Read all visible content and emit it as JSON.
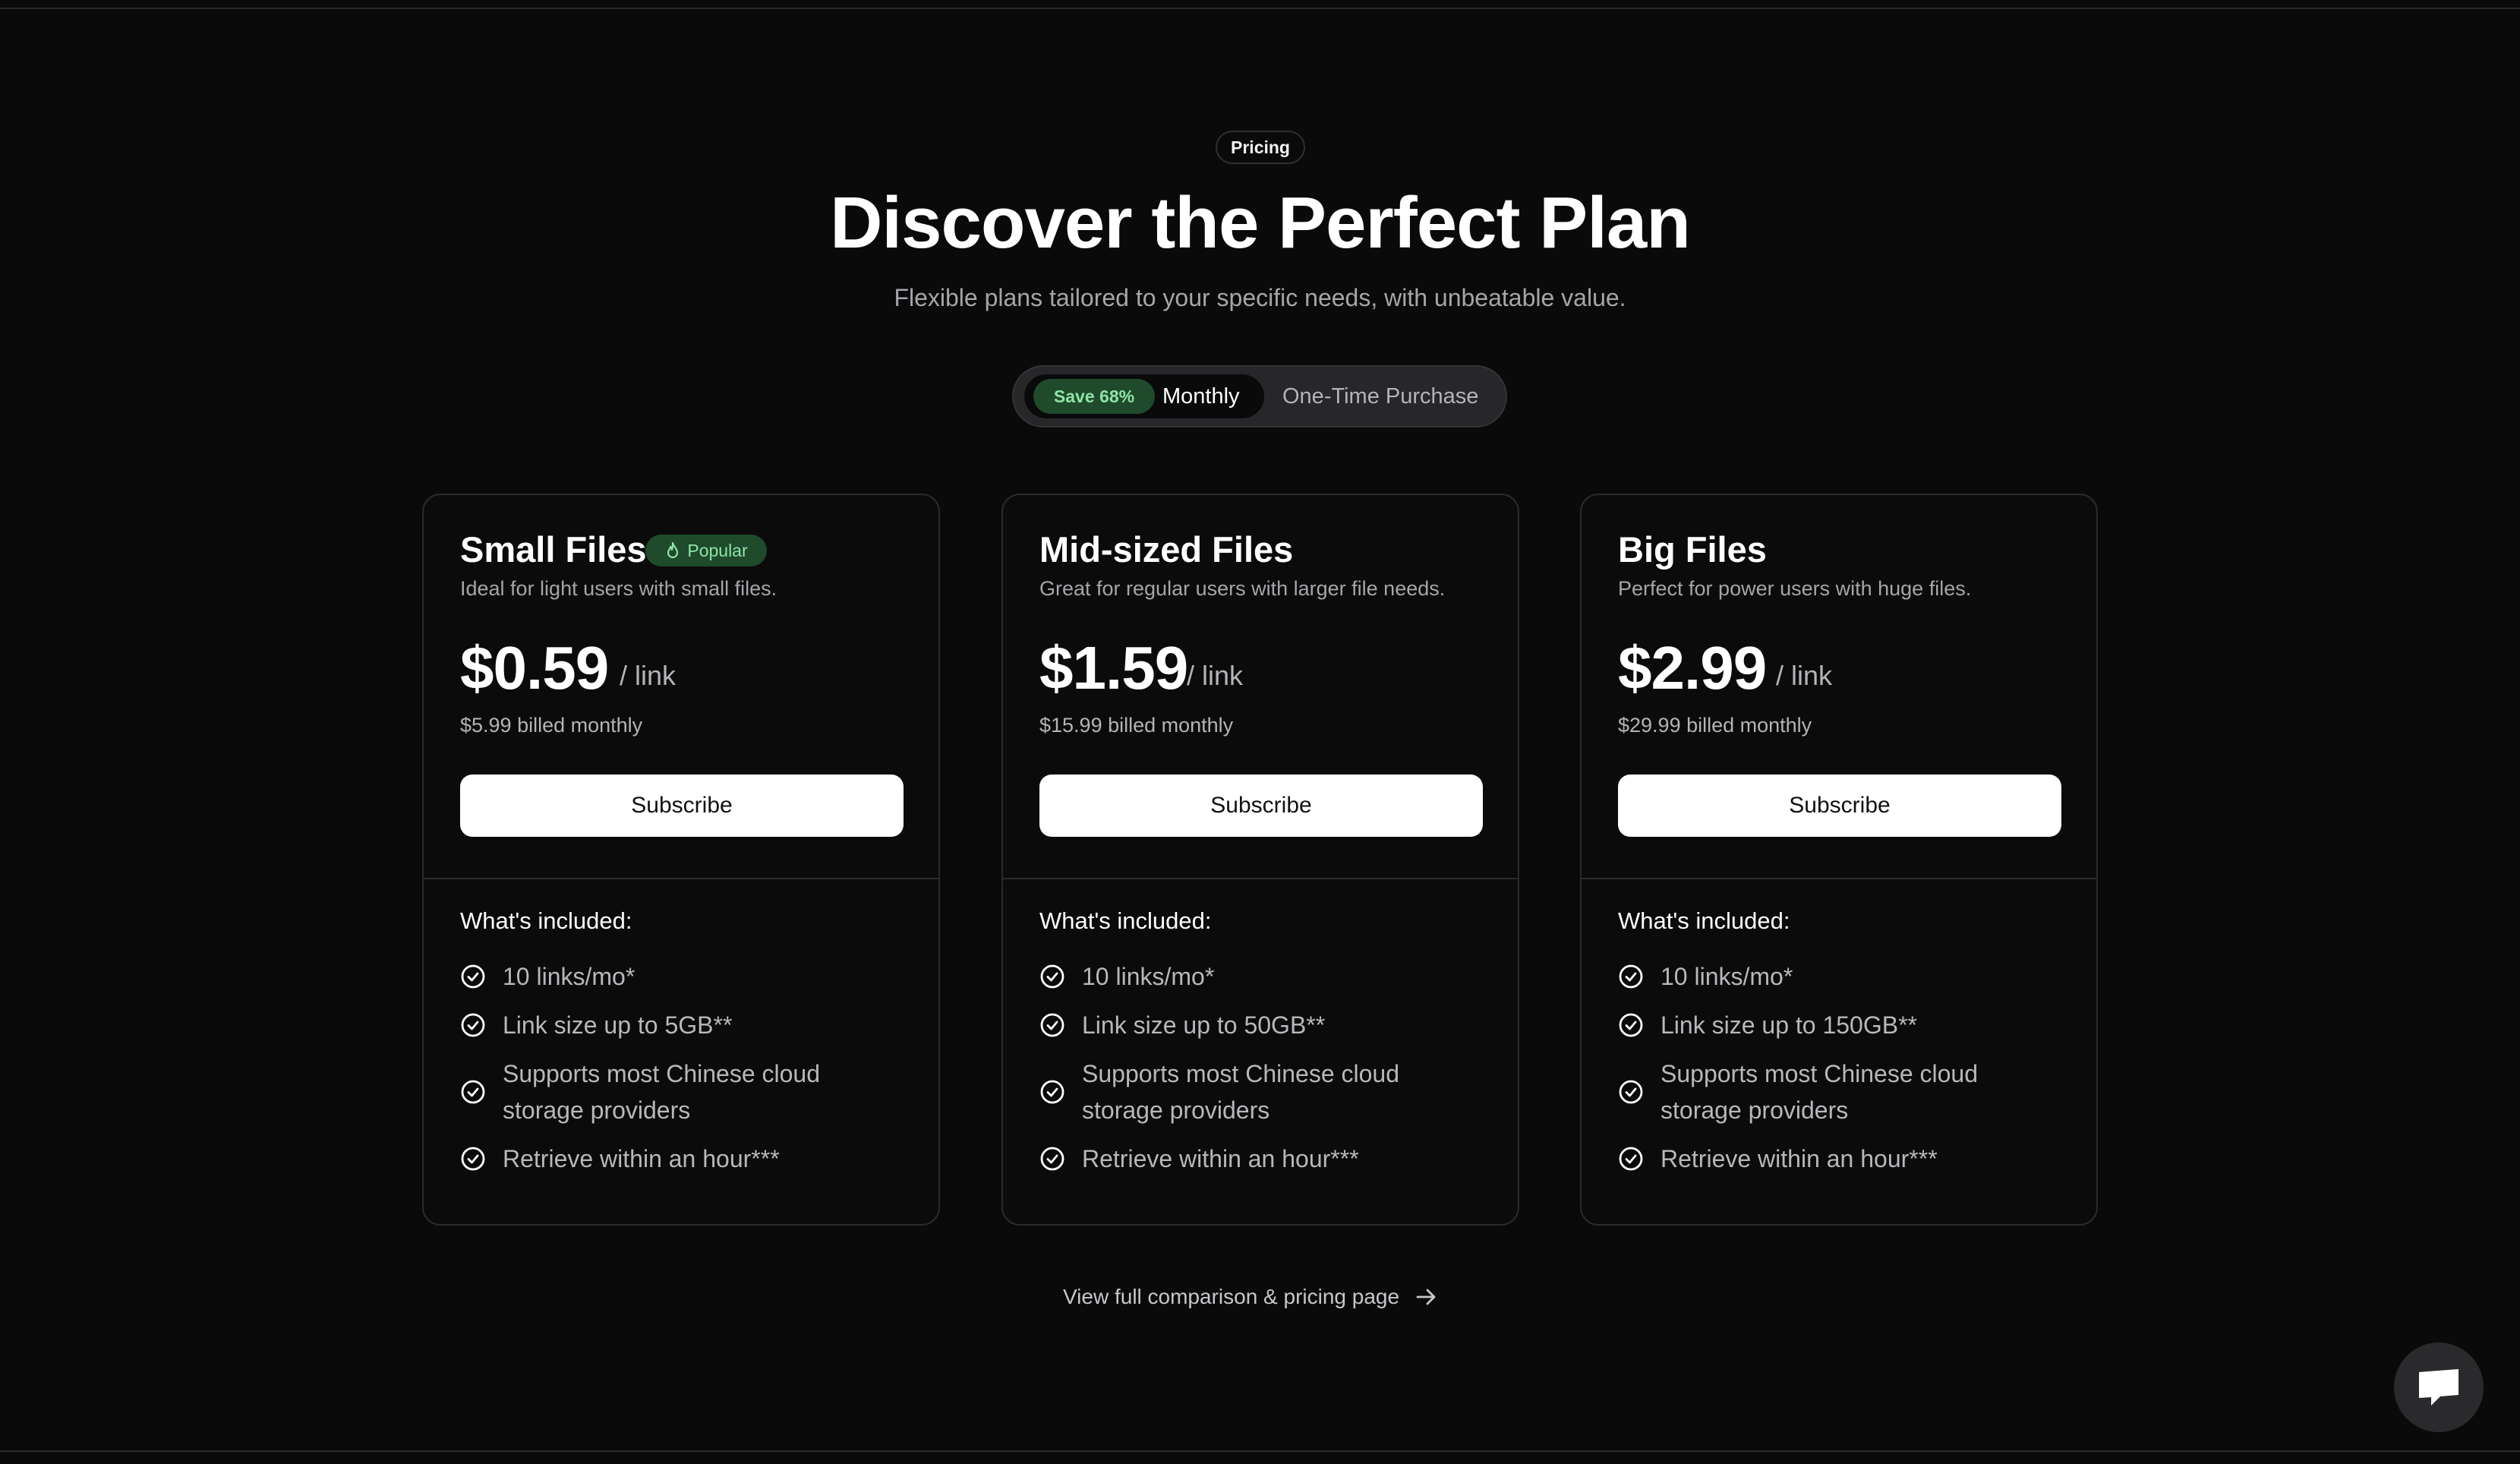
{
  "header": {
    "badge": "Pricing",
    "title": "Discover the Perfect Plan",
    "subtitle": "Flexible plans tailored to your specific needs, with unbeatable value."
  },
  "billing_toggle": {
    "save_label": "Save 68%",
    "monthly_label": "Monthly",
    "one_time_label": "One-Time Purchase",
    "selected": "Monthly"
  },
  "plans": [
    {
      "name": "Small Files",
      "badge": "Popular",
      "description": "Ideal for light users with small files.",
      "price": "$0.59",
      "unit": "/ link",
      "billed": "$5.99 billed monthly",
      "cta": "Subscribe",
      "included_title": "What's included:",
      "features": [
        "10 links/mo*",
        "Link size up to 5GB**",
        "Supports most Chinese cloud storage providers",
        "Retrieve within an hour***"
      ]
    },
    {
      "name": "Mid-sized Files",
      "description": "Great for regular users with larger file needs.",
      "price": "$1.59",
      "unit": "/ link",
      "billed": "$15.99 billed monthly",
      "cta": "Subscribe",
      "included_title": "What's included:",
      "features": [
        "10 links/mo*",
        "Link size up to 50GB**",
        "Supports most Chinese cloud storage providers",
        "Retrieve within an hour***"
      ]
    },
    {
      "name": "Big Files",
      "description": "Perfect for power users with huge files.",
      "price": "$2.99",
      "unit": "/ link",
      "billed": "$29.99 billed monthly",
      "cta": "Subscribe",
      "included_title": "What's included:",
      "features": [
        "10 links/mo*",
        "Link size up to 150GB**",
        "Supports most Chinese cloud storage providers",
        "Retrieve within an hour***"
      ]
    }
  ],
  "footer_link": "View full comparison & pricing page",
  "icons": {
    "feature": "check-circle-icon",
    "popular": "flame-icon",
    "link": "arrow-right-icon",
    "chat": "chat-bubble-icon"
  },
  "colors": {
    "background": "#0a0a0b",
    "accent_green_bg": "#1f4a2c",
    "accent_green_text": "#8fe3a5",
    "button_bg": "#ffffff"
  }
}
